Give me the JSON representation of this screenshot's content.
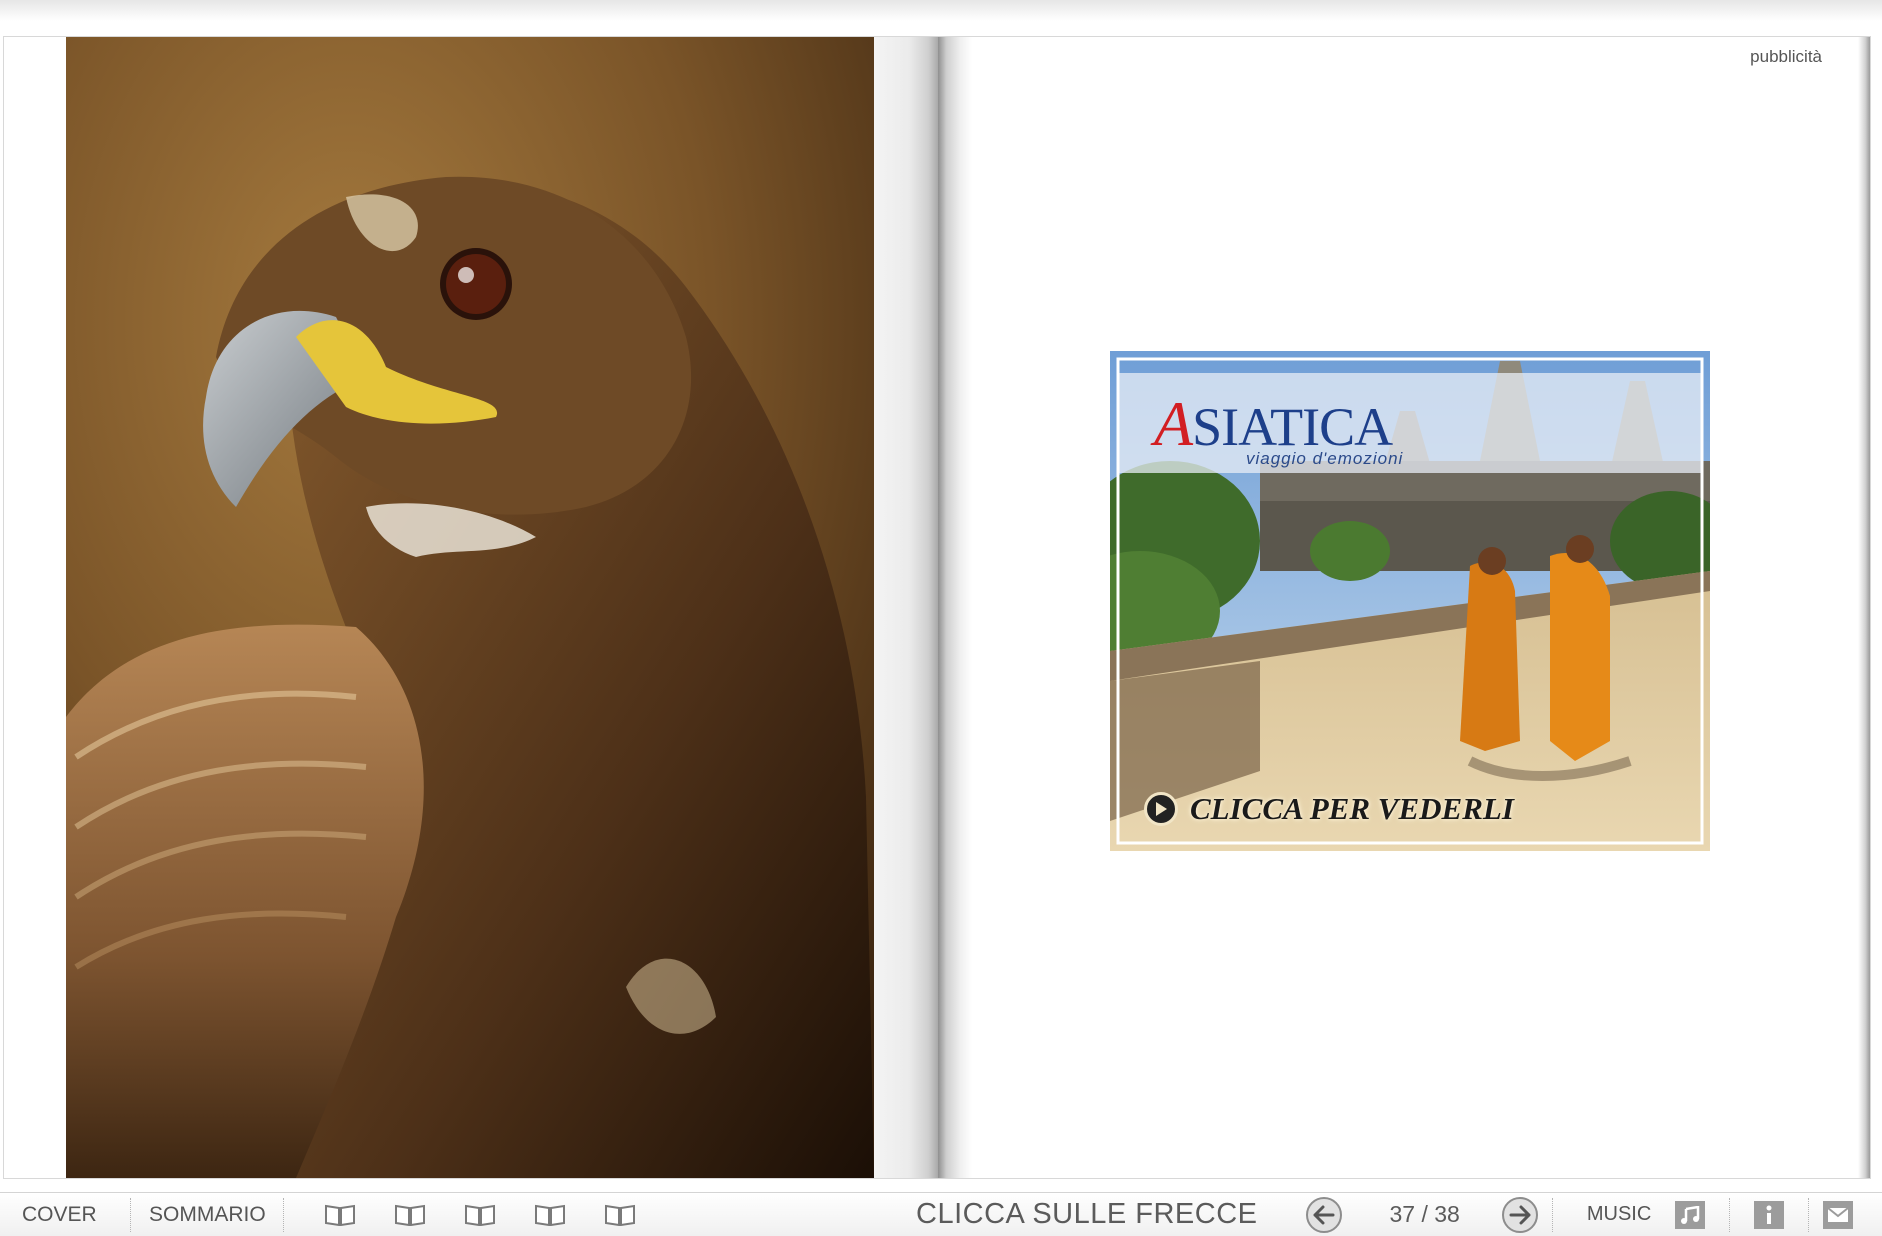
{
  "right_page": {
    "section_label": "pubblicità"
  },
  "ad": {
    "logo_first_letter": "A",
    "logo_rest": "SIATICA",
    "tagline": "viaggio d'emozioni",
    "cta_label": "CLICCA PER VEDERLI",
    "cta_icon": "play-circle-icon"
  },
  "toolbar": {
    "cover_label": "COVER",
    "contents_label": "SOMMARIO",
    "view_icons": [
      "book-view-1-icon",
      "book-view-2-icon",
      "book-view-3-icon",
      "book-view-4-icon",
      "book-view-5-icon"
    ],
    "nav_hint": "CLICCA SULLE FRECCE",
    "prev_icon": "arrow-left-icon",
    "page_counter": "37 / 38",
    "next_icon": "arrow-right-icon",
    "music_label": "MUSIC",
    "music_icon": "music-note-icon",
    "info_icon": "info-icon",
    "mail_icon": "mail-icon"
  }
}
